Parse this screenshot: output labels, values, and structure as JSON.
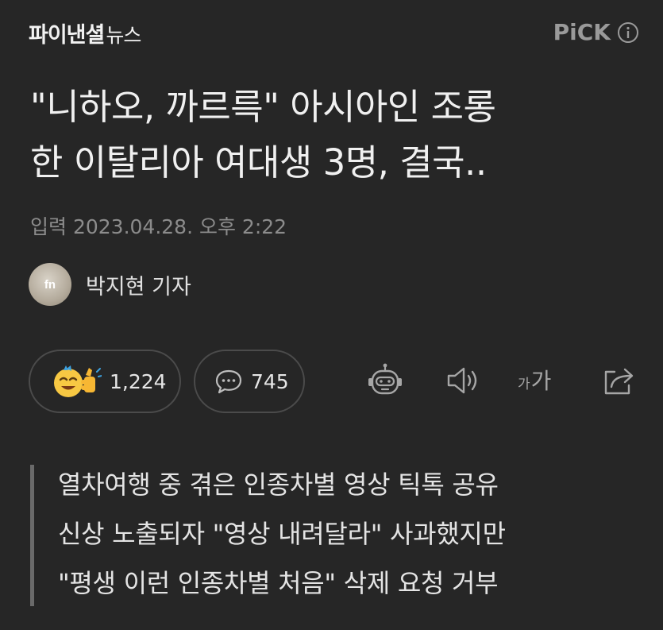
{
  "header": {
    "brand_name": "파이낸셜",
    "brand_suffix": "뉴스",
    "pick_label": "PiCK",
    "info_icon": "info-circle-icon"
  },
  "article": {
    "headline_lines": [
      "\"니하오, 까르륵\" 아시아인 조롱",
      "한 이탈리아 여대생 3명, 결국.."
    ],
    "published": "입력 2023.04.28. 오후 2:22",
    "author": {
      "avatar_text": "fn",
      "name": "박지현 기자"
    }
  },
  "actions": {
    "like_count": "1,224",
    "comment_count": "745",
    "font_size_small": "가",
    "font_size_large": "가",
    "icons": [
      "clap-emoji-icon",
      "comment-bubble-icon",
      "robot-summary-icon",
      "speaker-icon",
      "font-size-icon",
      "share-icon"
    ]
  },
  "summary": {
    "lines": [
      "열차여행 중 겪은 인종차별 영상 틱톡 공유",
      "신상 노출되자 \"영상 내려달라\" 사과했지만",
      "\"평생 이런 인종차별 처음\" 삭제 요청 거부"
    ]
  },
  "colors": {
    "background": "#262626",
    "text": "#f0f0f0",
    "muted": "#8c8c8c",
    "pill_border": "#4b4b4b"
  }
}
